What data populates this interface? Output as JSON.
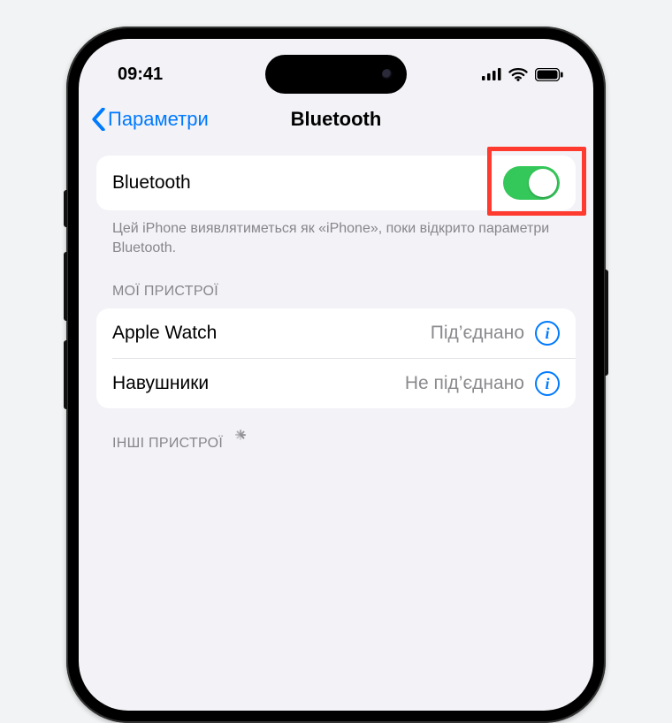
{
  "status": {
    "time": "09:41"
  },
  "nav": {
    "back": "Параметри",
    "title": "Bluetooth"
  },
  "bluetooth_row": {
    "label": "Bluetooth",
    "on": true
  },
  "footer": "Цей iPhone виявлятиметься як «iPhone», поки відкрито параметри Bluetooth.",
  "my_devices": {
    "header": "МОЇ ПРИСТРОЇ",
    "items": [
      {
        "name": "Apple Watch",
        "status": "Під’єднано"
      },
      {
        "name": "Навушники",
        "status": "Не під’єднано"
      }
    ]
  },
  "other_devices": {
    "header": "ІНШІ ПРИСТРОЇ"
  },
  "colors": {
    "accent": "#007aff",
    "toggle_on": "#34c759",
    "highlight": "#ff3b30"
  }
}
